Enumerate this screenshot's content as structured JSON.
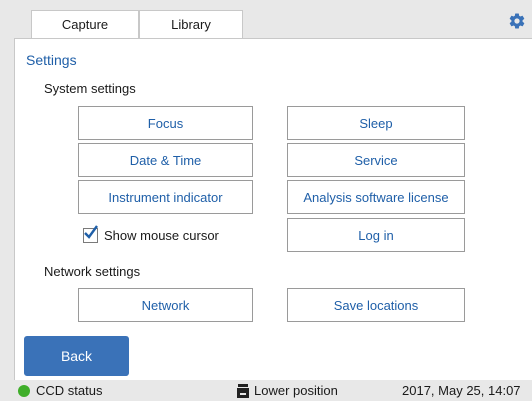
{
  "tabs": [
    {
      "label": "Capture"
    },
    {
      "label": "Library"
    }
  ],
  "settings_title": "Settings",
  "system_settings": {
    "label": "System settings",
    "buttons": {
      "focus": "Focus",
      "sleep": "Sleep",
      "date_time": "Date & Time",
      "service": "Service",
      "instrument_indicator": "Instrument indicator",
      "analysis_license": "Analysis software license",
      "log_in": "Log in"
    },
    "show_mouse_cursor": {
      "label": "Show mouse cursor",
      "checked": true
    }
  },
  "network_settings": {
    "label": "Network settings",
    "buttons": {
      "network": "Network",
      "save_locations": "Save locations"
    }
  },
  "back_label": "Back",
  "status": {
    "ccd": "CCD status",
    "ccd_color": "#3fae2a",
    "position": "Lower position",
    "datetime": "2017, May 25, 14:07"
  },
  "icons": {
    "settings": "gear-icon",
    "position": "lower-position-icon",
    "checkbox": "checkmark-icon"
  },
  "colors": {
    "accent": "#1f5fa8",
    "back_button": "#3a72b8"
  }
}
